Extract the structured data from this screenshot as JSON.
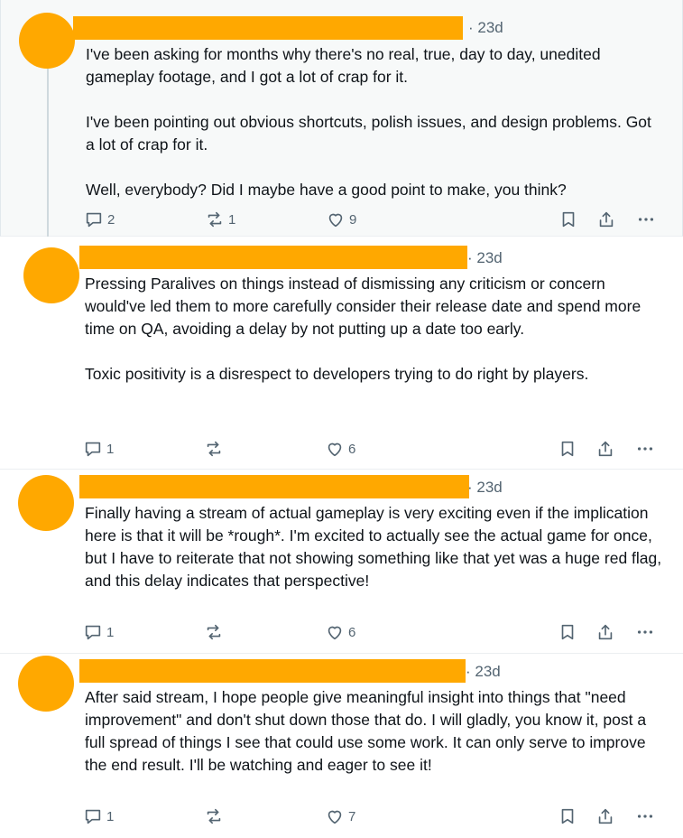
{
  "posts": [
    {
      "time": "· 23d",
      "paragraphs": [
        "I've been asking for months why there's no real, true, day to day, unedited gameplay footage, and I got a lot of crap for it.",
        "I've been pointing out obvious shortcuts, polish issues, and design problems. Got a lot of crap for it.",
        "Well, everybody? Did I maybe have a good point to make, you think?"
      ],
      "replies": "2",
      "reposts": "1",
      "likes": "9"
    },
    {
      "time": "· 23d",
      "paragraphs": [
        " Pressing Paralives on things instead of dismissing any criticism or concern would've led them to more carefully consider their release date and spend more time on QA, avoiding a delay by not putting up a date too early.",
        "Toxic positivity is a disrespect to developers trying to do right by players."
      ],
      "replies": "1",
      "reposts": "",
      "likes": "6"
    },
    {
      "time": "· 23d",
      "paragraphs": [
        "Finally having a stream of actual gameplay is very exciting even if the implication here is that it will be *rough*. I'm excited to actually see the actual game for once, but I have to reiterate that not showing something like that yet was a huge red flag, and this delay indicates that perspective!"
      ],
      "replies": "1",
      "reposts": "",
      "likes": "6"
    },
    {
      "time": "· 23d",
      "paragraphs": [
        "After said stream, I hope people give meaningful insight into things that \"need improvement\" and don't shut down those that do. I will gladly, you know it, post a full spread of things I see that could use some work. It can only serve to improve the end result. I'll be watching and eager to see it!"
      ],
      "replies": "1",
      "reposts": "",
      "likes": "7"
    }
  ],
  "icons": {
    "reply": "reply-icon",
    "repost": "repost-icon",
    "like": "heart-icon",
    "save": "bookmark-icon",
    "share": "share-icon",
    "more": "more-icon"
  },
  "colors": {
    "redaction": "#FFA800",
    "muted_text": "#536471",
    "text": "#0f1419",
    "highlight_bg": "#f7f9f9"
  }
}
